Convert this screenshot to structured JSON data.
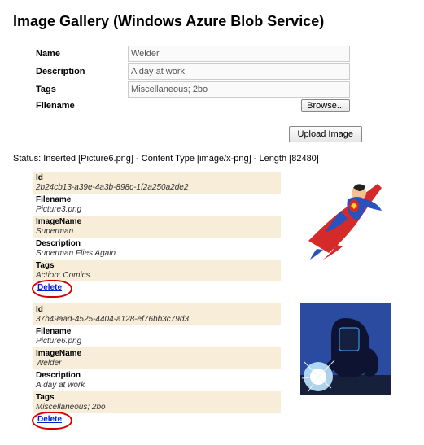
{
  "title": "Image Gallery (Windows Azure Blob Service)",
  "form": {
    "labels": {
      "name": "Name",
      "description": "Description",
      "tags": "Tags",
      "filename": "Filename"
    },
    "values": {
      "name": "Welder",
      "description": "A day at work",
      "tags": "Miscellaneous; 2bo"
    },
    "browse_label": "Browse...",
    "upload_label": "Upload Image"
  },
  "status": "Status: Inserted [Picture6.png] - Content Type [image/x-png] - Length [82480]",
  "field_labels": {
    "id": "Id",
    "filename": "Filename",
    "imagename": "ImageName",
    "description": "Description",
    "tags": "Tags"
  },
  "delete_label": "Delete",
  "entries": [
    {
      "id": "2b24cb13-a39e-4a3b-898c-1f2a250a2de2",
      "filename": "Picture3.png",
      "imagename": "Superman",
      "description": "Superman Flies Again",
      "tags": "Action; Comics",
      "thumb": "superman"
    },
    {
      "id": "37b49aad-4525-4404-a128-ef76bb3c79d3",
      "filename": "Picture6.png",
      "imagename": "Welder",
      "description": "A day at work",
      "tags": "Miscellaneous; 2bo",
      "thumb": "welder"
    }
  ]
}
